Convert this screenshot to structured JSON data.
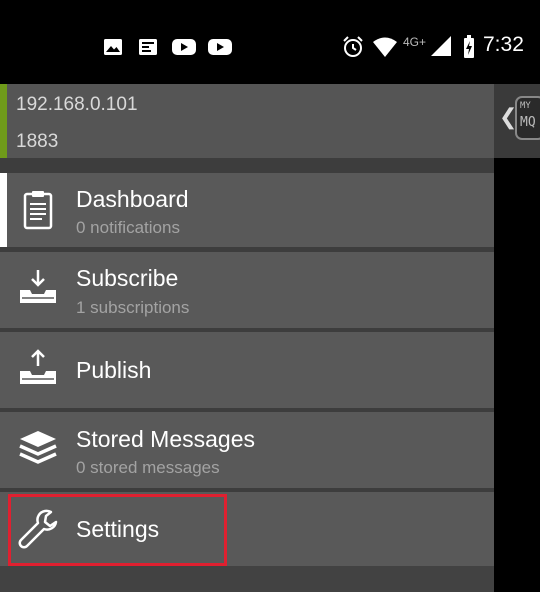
{
  "status_bar": {
    "time": "7:32",
    "network": "4G+",
    "icons": [
      "image-icon",
      "news-icon",
      "youtube-icon",
      "youtube-icon",
      "alarm-icon",
      "wifi-icon",
      "signal-icon",
      "battery-charging-icon"
    ]
  },
  "connection": {
    "host": "192.168.0.101",
    "port": "1883"
  },
  "menu": [
    {
      "label": "Dashboard",
      "subtitle": "0 notifications",
      "icon": "clipboard-icon",
      "selected": true
    },
    {
      "label": "Subscribe",
      "subtitle": "1 subscriptions",
      "icon": "inbox-download-icon"
    },
    {
      "label": "Publish",
      "subtitle": "",
      "icon": "inbox-upload-icon"
    },
    {
      "label": "Stored Messages",
      "subtitle": "0 stored messages",
      "icon": "layers-icon"
    },
    {
      "label": "Settings",
      "subtitle": "",
      "icon": "wrench-icon"
    }
  ],
  "right_strip": {
    "logo_line1": "MY",
    "logo_line2": "MQ"
  },
  "colors": {
    "accent_green": "#6f9a1a",
    "highlight_red": "#e02030",
    "item_bg": "#595959"
  }
}
